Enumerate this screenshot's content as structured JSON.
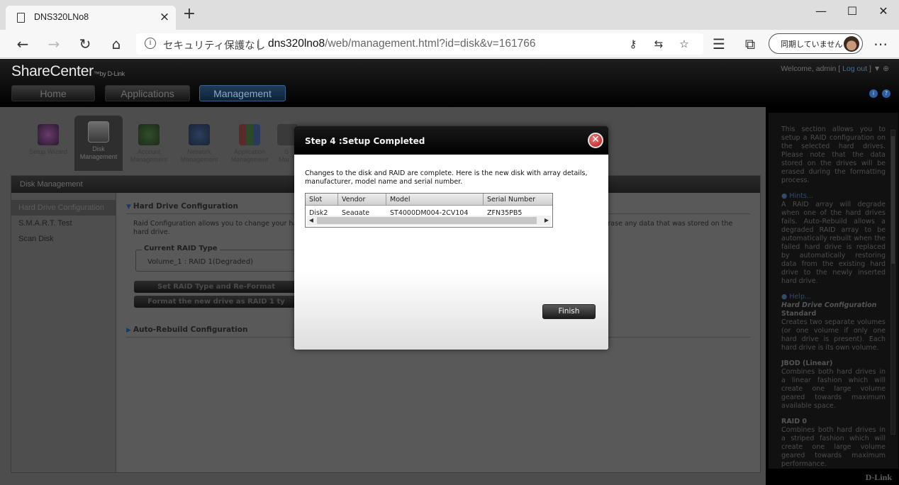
{
  "browser": {
    "tab_title": "DNS320LNo8",
    "tab_close": "×",
    "new_tab": "+",
    "address": {
      "security_label": "セキュリティ保護なし",
      "separator": "|",
      "url_host": "dns320lno8",
      "url_path": "/web/management.html?id=disk&v=161766"
    },
    "sync_label": "同期していません",
    "window_controls": {
      "minimize": "—",
      "maximize": "☐",
      "close": "✕"
    }
  },
  "header": {
    "logo": "ShareCenter",
    "logo_tm": "™",
    "logo_by": "by D-Link",
    "welcome_prefix": "Welcome, admin [",
    "logout": " Log out ",
    "welcome_suffix": "] ▼",
    "nav": {
      "home": "Home",
      "applications": "Applications",
      "management": "Management"
    }
  },
  "toolbar_icons": [
    {
      "line1": "Setup Wizard",
      "line2": ""
    },
    {
      "line1": "Disk",
      "line2": "Management"
    },
    {
      "line1": "Account",
      "line2": "Management"
    },
    {
      "line1": "Network",
      "line2": "Management"
    },
    {
      "line1": "Application",
      "line2": "Management"
    },
    {
      "line1": "S",
      "line2": "Mar"
    }
  ],
  "panel": {
    "title": "Disk Management",
    "sidebar": [
      "Hard Drive Configuration",
      "S.M.A.R.T. Test",
      "Scan Disk"
    ],
    "section1": "Hard Drive Configuration",
    "desc_left": "Raid Configuration allows you to change your hard",
    "desc_right": "vill erase any data that was stored on the",
    "desc_line2": "hard drive.",
    "raid_legend": "Current RAID Type",
    "raid_value": "Volume_1 : RAID 1(Degraded)",
    "btn_set_raid": "Set RAID Type and Re-Format",
    "btn_format_new": "Format the new drive as RAID 1 ty",
    "section2": "Auto-Rebuild Configuration"
  },
  "help": {
    "intro": "This section allows you to setup a RAID configuration on the selected hard drives. Please note that the data stored on the drives will be erased during the formatting process.",
    "hints_title": "Hints...",
    "hints": "A RAID array will degrade when one of the hard drives fails. Auto-Rebuild allows a degraded RAID array to be automatically rebuilt when the failed hard drive is replaced by automatically restoring data from the existing hard drive to the newly inserted hard drive.",
    "help_title": "Help...",
    "hd_config": "Hard Drive Configuration",
    "standard": "Standard",
    "standard_desc": "Creates two separate volumes (or one volume if only one hard drive is present). Each hard drive is its own volume.",
    "jbod": "JBOD (Linear)",
    "jbod_desc": "Combines both hard drives in a linear fashion which will create one large volume geared towards maximum available space.",
    "raid0": "RAID 0",
    "raid0_desc": "Combines both hard drives in a striped fashion which will create one large volume geared towards maximum performance.",
    "brand": "D-Link"
  },
  "modal": {
    "title": "Step 4 :Setup Completed",
    "close": "✕",
    "message": "Changes to the disk and RAID are complete. Here is the new disk with array details, manufacturer, model name and serial number.",
    "columns": [
      "Slot",
      "Vendor",
      "Model",
      "Serial Number"
    ],
    "row": [
      "Disk2",
      "Seagate",
      "ST4000DM004-2CV104",
      "ZFN35PB5"
    ],
    "scroll_left": "◀",
    "scroll_right": "▶",
    "finish": "Finish"
  }
}
